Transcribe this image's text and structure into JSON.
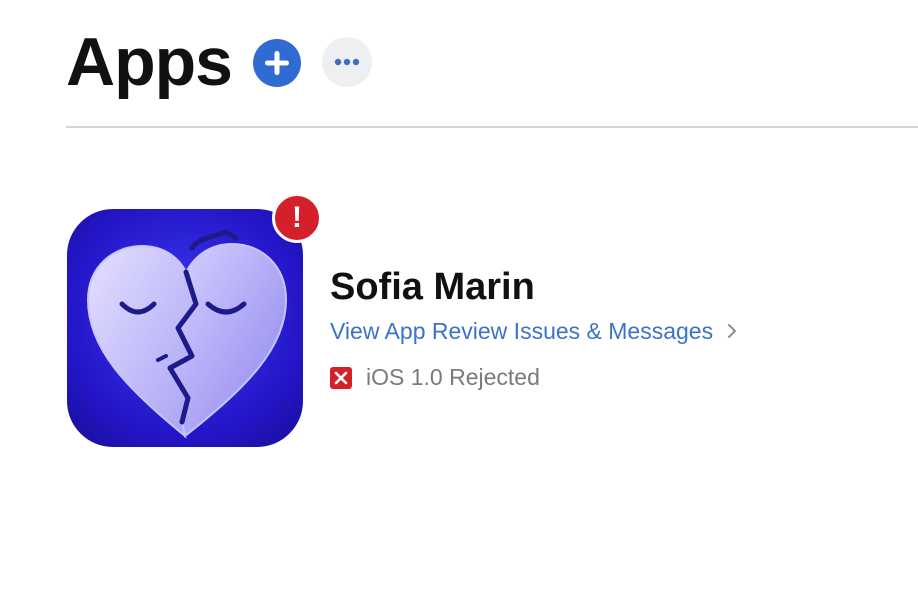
{
  "header": {
    "title": "Apps",
    "add_icon": "plus-circle-icon",
    "more_icon": "ellipsis-icon"
  },
  "apps": [
    {
      "name": "Sofia Marin",
      "icon": "heart-faces-app-icon",
      "badge_icon": "exclamation-icon",
      "badge_text": "!",
      "link_text": "View App Review Issues & Messages",
      "link_chevron": "chevron-right-icon",
      "status_icon": "x-square-icon",
      "status_text": "iOS 1.0 Rejected"
    }
  ],
  "colors": {
    "accent": "#2f6bd0",
    "link": "#3b73c9",
    "alert": "#d3202a",
    "muted": "#7a7a7e",
    "icon_bg": "#2a1fd0"
  }
}
